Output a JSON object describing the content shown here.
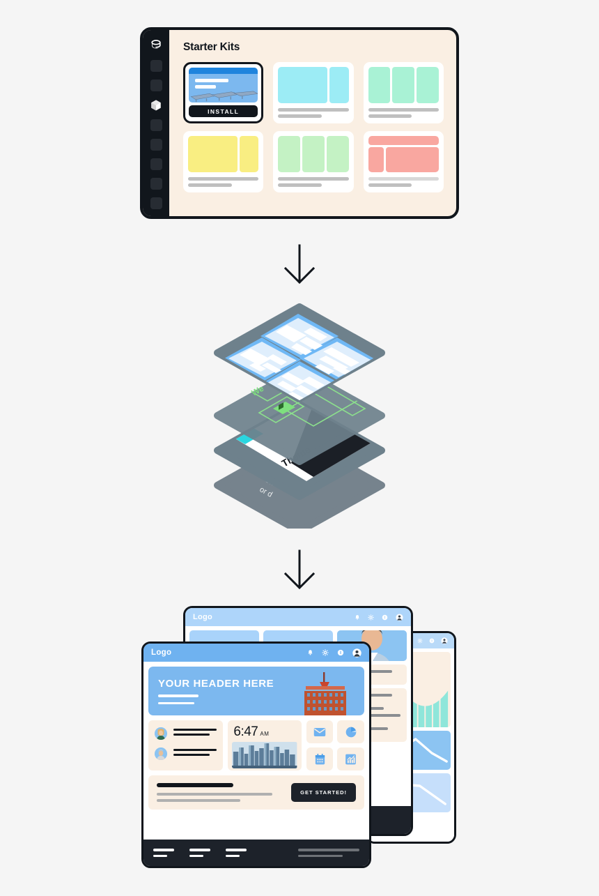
{
  "page": {
    "background_color": "#f5f5f5",
    "flow_steps": [
      "starter-kits",
      "layered-stack",
      "site-previews"
    ]
  },
  "step1_kits": {
    "window_title": "Starter Kits",
    "sidebar": {
      "logo_icon": "database-logo-icon",
      "items": [
        {
          "icon": "placeholder-square-icon",
          "active": false
        },
        {
          "icon": "placeholder-square-icon",
          "active": false
        },
        {
          "icon": "cube-package-icon",
          "active": true
        },
        {
          "icon": "placeholder-square-icon",
          "active": false
        },
        {
          "icon": "placeholder-square-icon",
          "active": false
        },
        {
          "icon": "placeholder-square-icon",
          "active": false
        },
        {
          "icon": "placeholder-square-icon",
          "active": false
        },
        {
          "icon": "placeholder-square-icon",
          "active": false
        }
      ]
    },
    "install_label": "INSTALL",
    "cards": [
      {
        "name": "solar-kit",
        "selected": true,
        "accent": "#7cb8ef",
        "layout": "hero-preview"
      },
      {
        "name": "cyan-kit",
        "selected": false,
        "accent": "#9cecf5",
        "layout": "two-column"
      },
      {
        "name": "mint-kit",
        "selected": false,
        "accent": "#a9f2d5",
        "layout": "three-column"
      },
      {
        "name": "yellow-kit",
        "selected": false,
        "accent": "#f9ee82",
        "layout": "two-column"
      },
      {
        "name": "green-kit",
        "selected": false,
        "accent": "#c4f2c4",
        "layout": "three-column"
      },
      {
        "name": "salmon-kit",
        "selected": false,
        "accent": "#f9a7a0",
        "layout": "header-split"
      }
    ]
  },
  "arrows": {
    "first": "down-arrow-icon",
    "second": "down-arrow-icon"
  },
  "step2_stack": {
    "description": "isometric layered stack",
    "layers": [
      {
        "name": "blocks-layer",
        "color": "#6e818c",
        "label": ""
      },
      {
        "name": "widgets-layer",
        "color": "#6e818c",
        "label": "We",
        "label_color": "#7ee07e"
      },
      {
        "name": "theme-layer",
        "color": "#ffffff",
        "label": "Theme",
        "label_color": "#11161c"
      },
      {
        "name": "base-layer",
        "color": "#76838d",
        "label": "Sh   or d",
        "label_color": "#ffffff"
      }
    ]
  },
  "step3_previews": {
    "front_window": {
      "logo": "Logo",
      "topbar_icons": [
        "bell-icon",
        "gear-icon",
        "info-icon",
        "avatar-icon"
      ],
      "hero_title": "YOUR HEADER HERE",
      "clock_time": "6:47",
      "clock_ampm": "AM",
      "tiles": [
        "envelope-icon",
        "pie-chart-icon",
        "calendar-icon",
        "bar-chart-icon"
      ],
      "cta_button": "GET STARTED!",
      "people_count": 2
    },
    "middle_window": {
      "logo": "Logo",
      "topbar_icons": [
        "bell-icon",
        "gear-icon",
        "info-icon",
        "avatar-icon"
      ]
    },
    "back_window": {
      "topbar_icons": [
        "gear-icon",
        "info-icon",
        "avatar-icon"
      ],
      "charts": [
        "area-bar-chart",
        "line-chart",
        "line-chart"
      ]
    }
  }
}
